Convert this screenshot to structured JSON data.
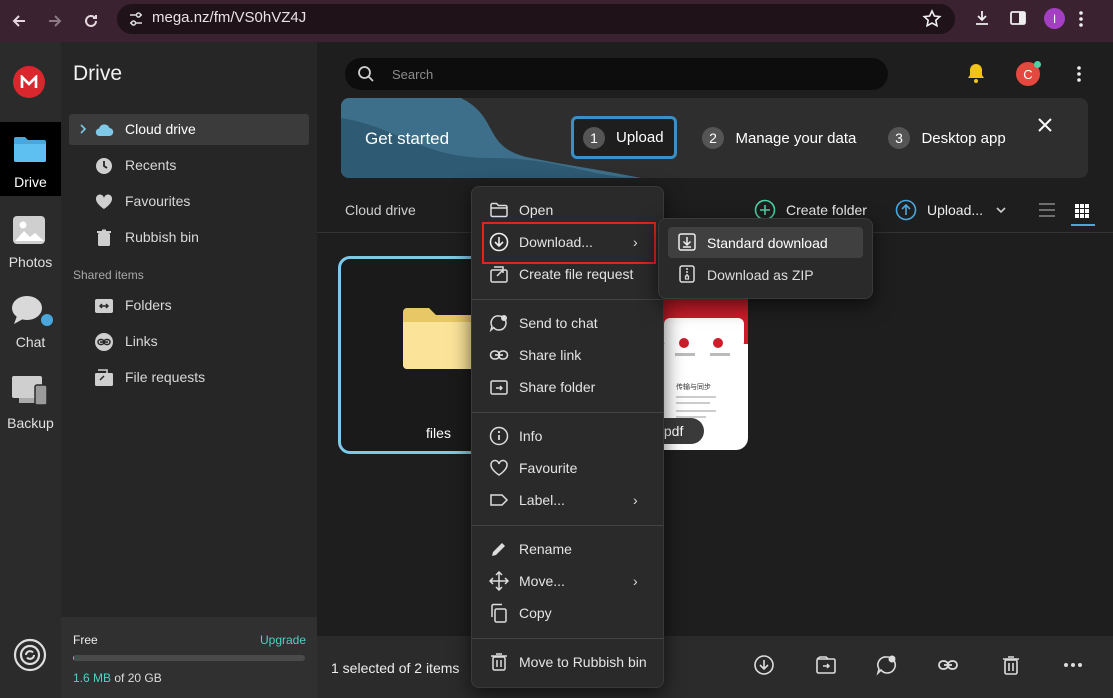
{
  "browser": {
    "url": "mega.nz/fm/VS0hVZ4J",
    "profile_initial": "I"
  },
  "leftnav": {
    "items": [
      {
        "label": "Drive",
        "icon": "folder-icon"
      },
      {
        "label": "Photos",
        "icon": "photos-icon"
      },
      {
        "label": "Chat",
        "icon": "chat-icon"
      },
      {
        "label": "Backup",
        "icon": "backup-icon"
      }
    ]
  },
  "sidebar": {
    "title": "Drive",
    "items": [
      {
        "label": "Cloud drive",
        "icon": "cloud-icon"
      },
      {
        "label": "Recents",
        "icon": "clock-icon"
      },
      {
        "label": "Favourites",
        "icon": "heart-icon"
      },
      {
        "label": "Rubbish bin",
        "icon": "trash-icon"
      }
    ],
    "shared_title": "Shared items",
    "shared_items": [
      {
        "label": "Folders",
        "icon": "shared-folder-icon"
      },
      {
        "label": "Links",
        "icon": "link-icon"
      },
      {
        "label": "File requests",
        "icon": "file-request-icon"
      }
    ],
    "storage": {
      "plan": "Free",
      "upgrade": "Upgrade",
      "used": "1.6 MB",
      "of_total": " of 20 GB",
      "fraction": 0.0001
    }
  },
  "header": {
    "search_placeholder": "Search",
    "avatar_initial": "C"
  },
  "banner": {
    "title": "Get started",
    "steps": [
      {
        "num": "1",
        "label": "Upload"
      },
      {
        "num": "2",
        "label": "Manage your data"
      },
      {
        "num": "3",
        "label": "Desktop app"
      }
    ]
  },
  "toolbar": {
    "breadcrumb": "Cloud drive",
    "create_folder": "Create folder",
    "upload": "Upload..."
  },
  "files": {
    "folder_name": "files",
    "pdf_name_visible": ".pdf",
    "pdf_texts": [
      "传输与同步"
    ]
  },
  "context_menu": {
    "open": "Open",
    "download": "Download...",
    "create_file_request": "Create file request",
    "send_to_chat": "Send to chat",
    "share_link": "Share link",
    "share_folder": "Share folder",
    "info": "Info",
    "favourite": "Favourite",
    "label": "Label...",
    "rename": "Rename",
    "move": "Move...",
    "copy": "Copy",
    "move_to_rubbish": "Move to Rubbish bin"
  },
  "submenu": {
    "standard_download": "Standard download",
    "download_zip": "Download as ZIP"
  },
  "bottombar": {
    "selection": "1 selected of 2 items"
  },
  "colors": {
    "mega_red": "#d9272e",
    "accent_teal": "#4fd1c5",
    "highlight_red": "#e0251c",
    "selected_blue": "#7ec8e8"
  }
}
